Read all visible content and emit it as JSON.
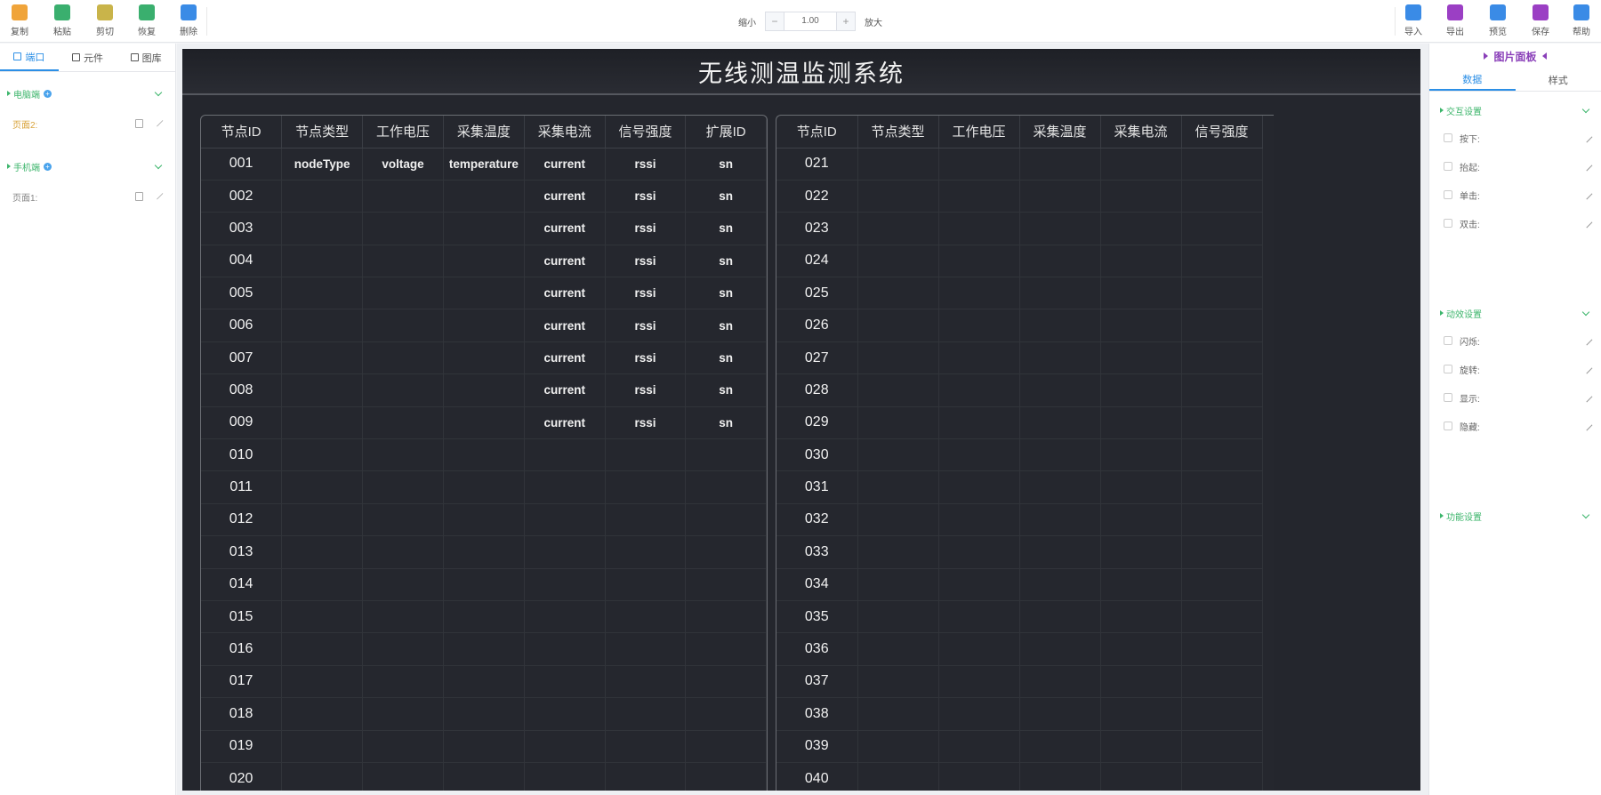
{
  "toolbar": {
    "left": [
      {
        "name": "copy",
        "label": "复制",
        "icon": "copy-icon",
        "color": "#f0a43a"
      },
      {
        "name": "paste",
        "label": "粘贴",
        "icon": "paste-icon",
        "color": "#3aaf6e"
      },
      {
        "name": "cut",
        "label": "剪切",
        "icon": "cut-icon",
        "color": "#c9b44a"
      },
      {
        "name": "undo",
        "label": "恢复",
        "icon": "undo-icon",
        "color": "#3aaf6e"
      },
      {
        "name": "delete",
        "label": "删除",
        "icon": "trash-icon",
        "color": "#3a8be6"
      }
    ],
    "zoom": {
      "minus_label": "缩小",
      "value": "1.00",
      "plus_label": "放大"
    },
    "right": [
      {
        "name": "import",
        "label": "导入",
        "icon": "import-icon",
        "color": "#3a8be6"
      },
      {
        "name": "export",
        "label": "导出",
        "icon": "export-icon",
        "color": "#9b3fc4"
      },
      {
        "name": "preview",
        "label": "预览",
        "icon": "eye-icon",
        "color": "#3a8be6"
      },
      {
        "name": "save",
        "label": "保存",
        "icon": "save-icon",
        "color": "#9b3fc4"
      },
      {
        "name": "help",
        "label": "帮助",
        "icon": "book-icon",
        "color": "#3a8be6"
      }
    ]
  },
  "sidebar": {
    "tabs": [
      "端口",
      "元件",
      "图库"
    ],
    "groups": [
      {
        "label": "电脑端",
        "pages": [
          {
            "label": "页面2:",
            "color": "#d9a33a"
          }
        ]
      },
      {
        "label": "手机端",
        "pages": [
          {
            "label": "页面1:",
            "color": "#888888"
          }
        ]
      }
    ]
  },
  "screen": {
    "title": "无线测温监测系统",
    "left_table": {
      "headers": [
        "节点ID",
        "节点类型",
        "工作电压",
        "采集温度",
        "采集电流",
        "信号强度",
        "扩展ID"
      ],
      "rows": [
        [
          "001",
          "nodeType",
          "voltage",
          "temperature",
          "current",
          "rssi",
          "sn"
        ],
        [
          "002",
          "",
          "",
          "",
          "current",
          "rssi",
          "sn"
        ],
        [
          "003",
          "",
          "",
          "",
          "current",
          "rssi",
          "sn"
        ],
        [
          "004",
          "",
          "",
          "",
          "current",
          "rssi",
          "sn"
        ],
        [
          "005",
          "",
          "",
          "",
          "current",
          "rssi",
          "sn"
        ],
        [
          "006",
          "",
          "",
          "",
          "current",
          "rssi",
          "sn"
        ],
        [
          "007",
          "",
          "",
          "",
          "current",
          "rssi",
          "sn"
        ],
        [
          "008",
          "",
          "",
          "",
          "current",
          "rssi",
          "sn"
        ],
        [
          "009",
          "",
          "",
          "",
          "current",
          "rssi",
          "sn"
        ],
        [
          "010",
          "",
          "",
          "",
          "",
          "",
          ""
        ],
        [
          "011",
          "",
          "",
          "",
          "",
          "",
          ""
        ],
        [
          "012",
          "",
          "",
          "",
          "",
          "",
          ""
        ],
        [
          "013",
          "",
          "",
          "",
          "",
          "",
          ""
        ],
        [
          "014",
          "",
          "",
          "",
          "",
          "",
          ""
        ],
        [
          "015",
          "",
          "",
          "",
          "",
          "",
          ""
        ],
        [
          "016",
          "",
          "",
          "",
          "",
          "",
          ""
        ],
        [
          "017",
          "",
          "",
          "",
          "",
          "",
          ""
        ],
        [
          "018",
          "",
          "",
          "",
          "",
          "",
          ""
        ],
        [
          "019",
          "",
          "",
          "",
          "",
          "",
          ""
        ],
        [
          "020",
          "",
          "",
          "",
          "",
          "",
          ""
        ]
      ]
    },
    "right_table": {
      "headers": [
        "节点ID",
        "节点类型",
        "工作电压",
        "采集温度",
        "采集电流",
        "信号强度"
      ],
      "rows": [
        [
          "021",
          "",
          "",
          "",
          "",
          ""
        ],
        [
          "022",
          "",
          "",
          "",
          "",
          ""
        ],
        [
          "023",
          "",
          "",
          "",
          "",
          ""
        ],
        [
          "024",
          "",
          "",
          "",
          "",
          ""
        ],
        [
          "025",
          "",
          "",
          "",
          "",
          ""
        ],
        [
          "026",
          "",
          "",
          "",
          "",
          ""
        ],
        [
          "027",
          "",
          "",
          "",
          "",
          ""
        ],
        [
          "028",
          "",
          "",
          "",
          "",
          ""
        ],
        [
          "029",
          "",
          "",
          "",
          "",
          ""
        ],
        [
          "030",
          "",
          "",
          "",
          "",
          ""
        ],
        [
          "031",
          "",
          "",
          "",
          "",
          ""
        ],
        [
          "032",
          "",
          "",
          "",
          "",
          ""
        ],
        [
          "033",
          "",
          "",
          "",
          "",
          ""
        ],
        [
          "034",
          "",
          "",
          "",
          "",
          ""
        ],
        [
          "035",
          "",
          "",
          "",
          "",
          ""
        ],
        [
          "036",
          "",
          "",
          "",
          "",
          ""
        ],
        [
          "037",
          "",
          "",
          "",
          "",
          ""
        ],
        [
          "038",
          "",
          "",
          "",
          "",
          ""
        ],
        [
          "039",
          "",
          "",
          "",
          "",
          ""
        ],
        [
          "040",
          "",
          "",
          "",
          "",
          ""
        ]
      ]
    }
  },
  "rightpanel": {
    "title": "图片面板",
    "tabs": [
      "数据",
      "样式"
    ],
    "sections": [
      {
        "label": "交互设置",
        "options": [
          "按下:",
          "抬起:",
          "单击:",
          "双击:"
        ]
      },
      {
        "label": "动效设置",
        "options": [
          "闪烁:",
          "旋转:",
          "显示:",
          "隐藏:"
        ]
      },
      {
        "label": "功能设置",
        "options": []
      }
    ]
  }
}
